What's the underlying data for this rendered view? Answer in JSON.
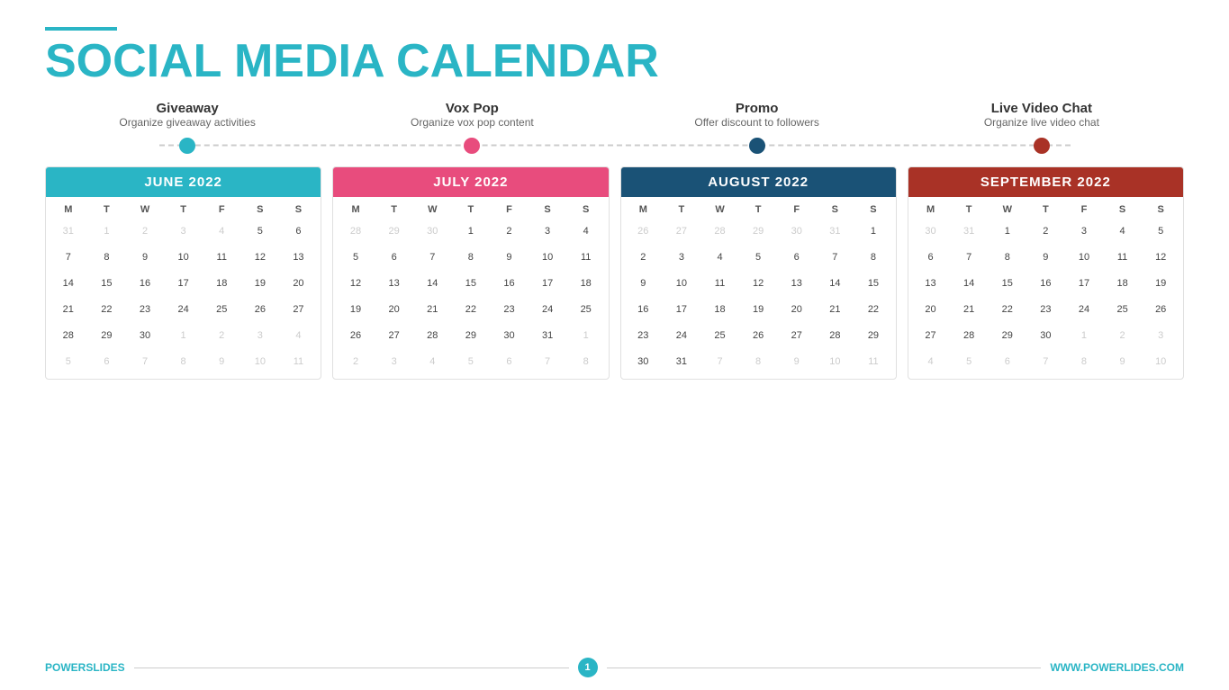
{
  "title": {
    "part1": "SOCIAL MEDIA ",
    "part2": "CALENDAR"
  },
  "categories": [
    {
      "id": "giveaway",
      "title": "Giveaway",
      "sub": "Organize giveaway activities",
      "dot_color": "dot-blue"
    },
    {
      "id": "voxpop",
      "title": "Vox Pop",
      "sub": "Organize vox pop content",
      "dot_color": "dot-pink"
    },
    {
      "id": "promo",
      "title": "Promo",
      "sub": "Offer discount to followers",
      "dot_color": "dot-darkblue"
    },
    {
      "id": "livechat",
      "title": "Live Video Chat",
      "sub": "Organize live video chat",
      "dot_color": "dot-darkred"
    }
  ],
  "calendars": [
    {
      "id": "june",
      "month": "JUNE 2022",
      "header_class": "cal-header-blue",
      "highlight_class": "highlight-blue",
      "days": [
        "M",
        "T",
        "W",
        "T",
        "F",
        "S",
        "S"
      ],
      "rows": [
        [
          "31",
          "1",
          "2",
          "3",
          "4",
          "5",
          "6"
        ],
        [
          "7",
          "8",
          "9",
          "10",
          "11",
          "12",
          "13"
        ],
        [
          "14",
          "15",
          "16",
          "17",
          "18",
          "19",
          "20"
        ],
        [
          "21",
          "22",
          "23",
          "24",
          "25",
          "26",
          "27"
        ],
        [
          "28",
          "29",
          "30",
          "1",
          "2",
          "3",
          "4"
        ],
        [
          "5",
          "6",
          "7",
          "8",
          "9",
          "10",
          "11"
        ]
      ],
      "muted": [
        "31",
        "1",
        "2",
        "3",
        "4"
      ],
      "highlights": [
        "5",
        "14",
        "24"
      ]
    },
    {
      "id": "july",
      "month": "JULY 2022",
      "header_class": "cal-header-pink",
      "highlight_class": "highlight-pink",
      "days": [
        "M",
        "T",
        "W",
        "T",
        "F",
        "S",
        "S"
      ],
      "rows": [
        [
          "28",
          "29",
          "30",
          "1",
          "2",
          "3",
          "4"
        ],
        [
          "5",
          "6",
          "7",
          "8",
          "9",
          "10",
          "11"
        ],
        [
          "12",
          "13",
          "14",
          "15",
          "16",
          "17",
          "18"
        ],
        [
          "19",
          "20",
          "21",
          "22",
          "23",
          "24",
          "25"
        ],
        [
          "26",
          "27",
          "28",
          "29",
          "30",
          "31",
          "1"
        ],
        [
          "2",
          "3",
          "4",
          "5",
          "6",
          "7",
          "8"
        ]
      ],
      "muted": [
        "28",
        "29",
        "30",
        "1",
        "2",
        "3",
        "4",
        "5",
        "6",
        "7",
        "8"
      ],
      "highlights": [
        "8",
        "18",
        "27"
      ]
    },
    {
      "id": "august",
      "month": "AUGUST 2022",
      "header_class": "cal-header-darkblue",
      "highlight_class": "highlight-darkblue",
      "days": [
        "M",
        "T",
        "W",
        "T",
        "F",
        "S",
        "S"
      ],
      "rows": [
        [
          "26",
          "27",
          "28",
          "29",
          "30",
          "31",
          "1"
        ],
        [
          "2",
          "3",
          "4",
          "5",
          "6",
          "7",
          "8"
        ],
        [
          "9",
          "10",
          "11",
          "12",
          "13",
          "14",
          "15"
        ],
        [
          "16",
          "17",
          "18",
          "19",
          "20",
          "21",
          "22"
        ],
        [
          "23",
          "24",
          "25",
          "26",
          "27",
          "28",
          "29"
        ],
        [
          "30",
          "31",
          "7",
          "8",
          "9",
          "10",
          "11"
        ]
      ],
      "muted": [
        "26",
        "27",
        "28",
        "29",
        "30",
        "31",
        "7",
        "8",
        "9",
        "10",
        "11"
      ],
      "highlights": [
        "1",
        "8",
        "19",
        "29"
      ]
    },
    {
      "id": "september",
      "month": "SEPTEMBER 2022",
      "header_class": "cal-header-darkred",
      "highlight_class": "highlight-darkred",
      "days": [
        "M",
        "T",
        "W",
        "T",
        "F",
        "S",
        "S"
      ],
      "rows": [
        [
          "30",
          "31",
          "1",
          "2",
          "3",
          "4",
          "5"
        ],
        [
          "6",
          "7",
          "8",
          "9",
          "10",
          "11",
          "12"
        ],
        [
          "13",
          "14",
          "15",
          "16",
          "17",
          "18",
          "19"
        ],
        [
          "20",
          "21",
          "22",
          "23",
          "24",
          "25",
          "26"
        ],
        [
          "27",
          "28",
          "29",
          "30",
          "1",
          "2",
          "3"
        ],
        [
          "4",
          "5",
          "6",
          "7",
          "8",
          "9",
          "10"
        ]
      ],
      "muted": [
        "30",
        "31",
        "1",
        "2",
        "3",
        "4",
        "5",
        "1",
        "2",
        "3",
        "4",
        "5",
        "6",
        "7",
        "8",
        "9",
        "10"
      ],
      "highlights": [
        "12",
        "18",
        "27"
      ]
    }
  ],
  "footer": {
    "brand_black": "POWER",
    "brand_teal": "SLIDES",
    "page_number": "1",
    "website": "WWW.POWERLIDES.COM"
  }
}
